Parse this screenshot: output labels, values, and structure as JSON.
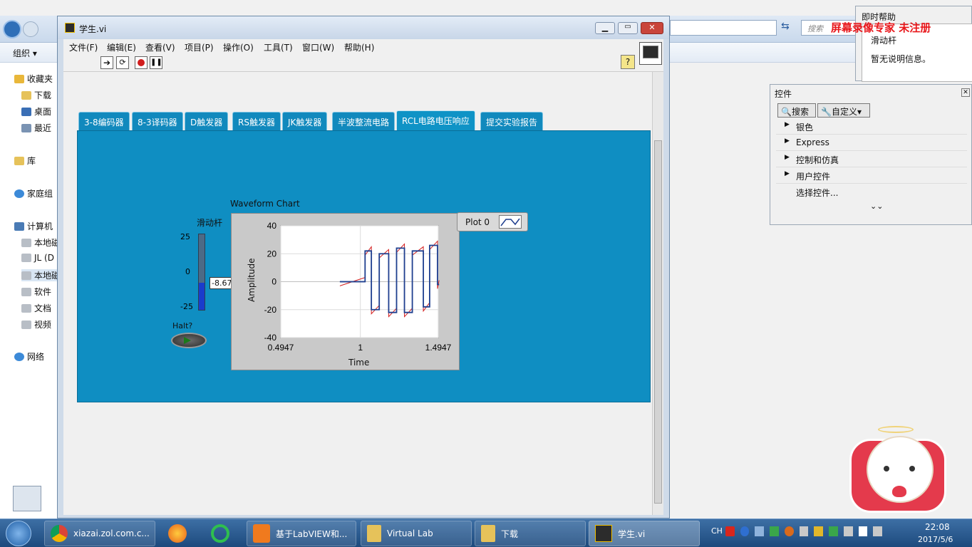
{
  "explorer": {
    "organize_label": "组织 ▾",
    "nav_items": [
      "收藏夹",
      "下载",
      "桌面",
      "最近",
      "库",
      "家庭组",
      "计算机",
      "本地磁",
      "JL (D",
      "本地磁",
      "软件",
      "文档",
      "视频",
      "网络"
    ],
    "search_placeholder": "搜索"
  },
  "watermark": "屏幕录像专家 未注册",
  "window": {
    "title": "学生.vi",
    "menu": [
      "文件(F)",
      "编辑(E)",
      "查看(V)",
      "项目(P)",
      "操作(O)",
      "工具(T)",
      "窗口(W)",
      "帮助(H)"
    ]
  },
  "tabs": [
    "3-8编码器",
    "8-3译码器",
    "D触发器",
    "RS触发器",
    "JK触发器",
    "半波整流电路",
    "RCL电路电压响应",
    "提交实验报告"
  ],
  "active_tab_index": 6,
  "slider": {
    "label": "滑动杆",
    "ticks": [
      "25",
      "0",
      "-25"
    ],
    "value_display": "-8.67347",
    "value": -8.67347,
    "range": [
      -30,
      30
    ]
  },
  "halt": {
    "label": "Halt?"
  },
  "chart": {
    "title": "Waveform Chart",
    "legend_label": "Plot 0",
    "xlabel": "Time",
    "ylabel": "Amplitude",
    "x_ticks": [
      "0.4947",
      "1",
      "1.4947"
    ],
    "y_ticks": [
      "40",
      "20",
      "0",
      "-20",
      "-40"
    ]
  },
  "chart_data": {
    "type": "line",
    "title": "Waveform Chart",
    "xlabel": "Time",
    "ylabel": "Amplitude",
    "xlim": [
      0.4947,
      1.4947
    ],
    "ylim": [
      -40,
      40
    ],
    "grid": true,
    "legend": "top-right",
    "series": [
      {
        "name": "Plot 0",
        "color": "#1f3f8f",
        "x": [
          0.87,
          1.03,
          1.03,
          1.07,
          1.07,
          1.12,
          1.12,
          1.18,
          1.18,
          1.23,
          1.23,
          1.28,
          1.28,
          1.33,
          1.33,
          1.4,
          1.4,
          1.44,
          1.44,
          1.49,
          1.49,
          1.5
        ],
        "y": [
          0,
          0,
          22,
          22,
          -20,
          -20,
          20,
          20,
          -22,
          -22,
          24,
          24,
          -22,
          -22,
          22,
          22,
          -18,
          -18,
          26,
          26,
          -2,
          -2
        ]
      }
    ]
  },
  "controls_palette": {
    "title": "控件",
    "search_label": "搜索",
    "custom_label": "自定义▾",
    "items": [
      "银色",
      "Express",
      "控制和仿真",
      "用户控件",
      "选择控件..."
    ]
  },
  "help_panel": {
    "title": "即时帮助",
    "item": "滑动杆",
    "text": "暂无说明信息。"
  },
  "taskbar": {
    "items": [
      "xiazai.zol.com.c...",
      "",
      "",
      "基于LabVIEW和...",
      "Virtual Lab",
      "下载",
      "学生.vi"
    ],
    "lang": "CH",
    "time": "22:08",
    "date": "2017/5/6"
  }
}
